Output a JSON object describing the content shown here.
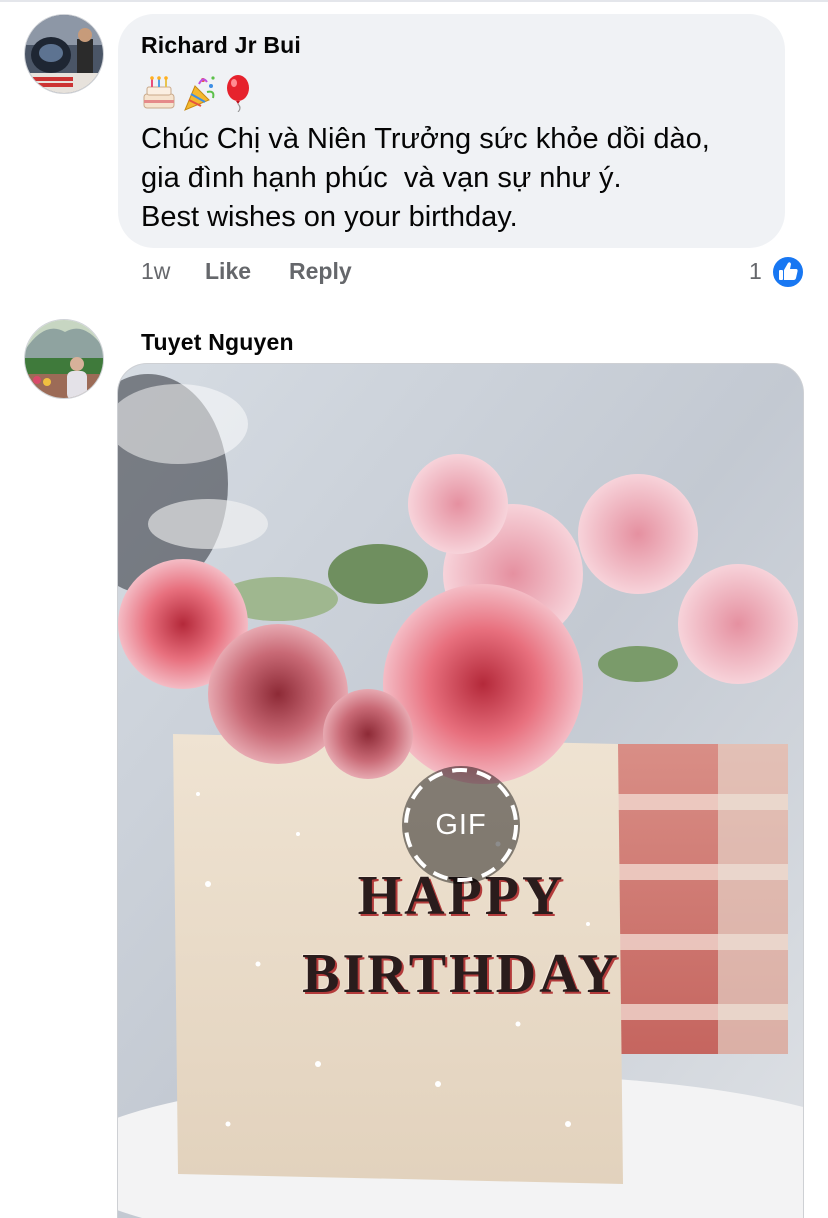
{
  "comments": [
    {
      "author": "Richard Jr Bui",
      "emojis": [
        "birthday-cake-emoji",
        "party-popper-emoji",
        "balloon-emoji"
      ],
      "lines": [
        "Chúc Chị và Niên Trưởng sức khỏe dồi dào,",
        "gia đình hạnh phúc  và vạn sự như ý.",
        "Best wishes on your birthday."
      ],
      "time": "1w",
      "like_label": "Like",
      "reply_label": "Reply",
      "reaction_count": "1",
      "reaction_icon": "like-icon"
    },
    {
      "author": "Tuyet Nguyen",
      "gif": {
        "badge_label": "GIF",
        "cake_text_line1": "HAPPY",
        "cake_text_line2": "BIRTHDAY"
      }
    }
  ],
  "colors": {
    "bubble_bg": "#f0f2f5",
    "meta_text": "#65676b",
    "like_blue": "#1877f2"
  }
}
